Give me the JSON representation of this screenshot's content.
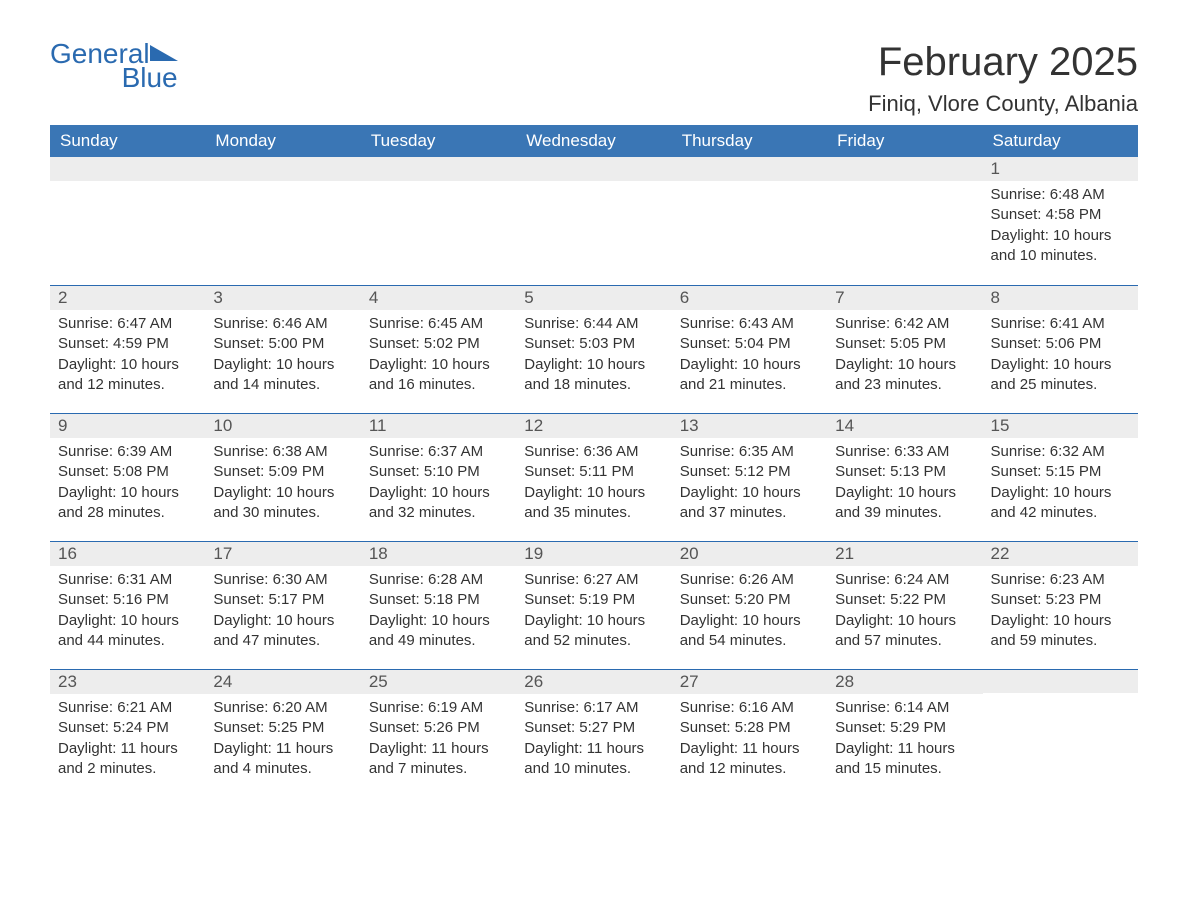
{
  "brand": {
    "general": "General",
    "blue": "Blue"
  },
  "title": "February 2025",
  "location": "Finiq, Vlore County, Albania",
  "day_headers": [
    "Sunday",
    "Monday",
    "Tuesday",
    "Wednesday",
    "Thursday",
    "Friday",
    "Saturday"
  ],
  "weeks": [
    [
      {
        "n": "",
        "lines": []
      },
      {
        "n": "",
        "lines": []
      },
      {
        "n": "",
        "lines": []
      },
      {
        "n": "",
        "lines": []
      },
      {
        "n": "",
        "lines": []
      },
      {
        "n": "",
        "lines": []
      },
      {
        "n": "1",
        "lines": [
          "Sunrise: 6:48 AM",
          "Sunset: 4:58 PM",
          "Daylight: 10 hours and 10 minutes."
        ]
      }
    ],
    [
      {
        "n": "2",
        "lines": [
          "Sunrise: 6:47 AM",
          "Sunset: 4:59 PM",
          "Daylight: 10 hours and 12 minutes."
        ]
      },
      {
        "n": "3",
        "lines": [
          "Sunrise: 6:46 AM",
          "Sunset: 5:00 PM",
          "Daylight: 10 hours and 14 minutes."
        ]
      },
      {
        "n": "4",
        "lines": [
          "Sunrise: 6:45 AM",
          "Sunset: 5:02 PM",
          "Daylight: 10 hours and 16 minutes."
        ]
      },
      {
        "n": "5",
        "lines": [
          "Sunrise: 6:44 AM",
          "Sunset: 5:03 PM",
          "Daylight: 10 hours and 18 minutes."
        ]
      },
      {
        "n": "6",
        "lines": [
          "Sunrise: 6:43 AM",
          "Sunset: 5:04 PM",
          "Daylight: 10 hours and 21 minutes."
        ]
      },
      {
        "n": "7",
        "lines": [
          "Sunrise: 6:42 AM",
          "Sunset: 5:05 PM",
          "Daylight: 10 hours and 23 minutes."
        ]
      },
      {
        "n": "8",
        "lines": [
          "Sunrise: 6:41 AM",
          "Sunset: 5:06 PM",
          "Daylight: 10 hours and 25 minutes."
        ]
      }
    ],
    [
      {
        "n": "9",
        "lines": [
          "Sunrise: 6:39 AM",
          "Sunset: 5:08 PM",
          "Daylight: 10 hours and 28 minutes."
        ]
      },
      {
        "n": "10",
        "lines": [
          "Sunrise: 6:38 AM",
          "Sunset: 5:09 PM",
          "Daylight: 10 hours and 30 minutes."
        ]
      },
      {
        "n": "11",
        "lines": [
          "Sunrise: 6:37 AM",
          "Sunset: 5:10 PM",
          "Daylight: 10 hours and 32 minutes."
        ]
      },
      {
        "n": "12",
        "lines": [
          "Sunrise: 6:36 AM",
          "Sunset: 5:11 PM",
          "Daylight: 10 hours and 35 minutes."
        ]
      },
      {
        "n": "13",
        "lines": [
          "Sunrise: 6:35 AM",
          "Sunset: 5:12 PM",
          "Daylight: 10 hours and 37 minutes."
        ]
      },
      {
        "n": "14",
        "lines": [
          "Sunrise: 6:33 AM",
          "Sunset: 5:13 PM",
          "Daylight: 10 hours and 39 minutes."
        ]
      },
      {
        "n": "15",
        "lines": [
          "Sunrise: 6:32 AM",
          "Sunset: 5:15 PM",
          "Daylight: 10 hours and 42 minutes."
        ]
      }
    ],
    [
      {
        "n": "16",
        "lines": [
          "Sunrise: 6:31 AM",
          "Sunset: 5:16 PM",
          "Daylight: 10 hours and 44 minutes."
        ]
      },
      {
        "n": "17",
        "lines": [
          "Sunrise: 6:30 AM",
          "Sunset: 5:17 PM",
          "Daylight: 10 hours and 47 minutes."
        ]
      },
      {
        "n": "18",
        "lines": [
          "Sunrise: 6:28 AM",
          "Sunset: 5:18 PM",
          "Daylight: 10 hours and 49 minutes."
        ]
      },
      {
        "n": "19",
        "lines": [
          "Sunrise: 6:27 AM",
          "Sunset: 5:19 PM",
          "Daylight: 10 hours and 52 minutes."
        ]
      },
      {
        "n": "20",
        "lines": [
          "Sunrise: 6:26 AM",
          "Sunset: 5:20 PM",
          "Daylight: 10 hours and 54 minutes."
        ]
      },
      {
        "n": "21",
        "lines": [
          "Sunrise: 6:24 AM",
          "Sunset: 5:22 PM",
          "Daylight: 10 hours and 57 minutes."
        ]
      },
      {
        "n": "22",
        "lines": [
          "Sunrise: 6:23 AM",
          "Sunset: 5:23 PM",
          "Daylight: 10 hours and 59 minutes."
        ]
      }
    ],
    [
      {
        "n": "23",
        "lines": [
          "Sunrise: 6:21 AM",
          "Sunset: 5:24 PM",
          "Daylight: 11 hours and 2 minutes."
        ]
      },
      {
        "n": "24",
        "lines": [
          "Sunrise: 6:20 AM",
          "Sunset: 5:25 PM",
          "Daylight: 11 hours and 4 minutes."
        ]
      },
      {
        "n": "25",
        "lines": [
          "Sunrise: 6:19 AM",
          "Sunset: 5:26 PM",
          "Daylight: 11 hours and 7 minutes."
        ]
      },
      {
        "n": "26",
        "lines": [
          "Sunrise: 6:17 AM",
          "Sunset: 5:27 PM",
          "Daylight: 11 hours and 10 minutes."
        ]
      },
      {
        "n": "27",
        "lines": [
          "Sunrise: 6:16 AM",
          "Sunset: 5:28 PM",
          "Daylight: 11 hours and 12 minutes."
        ]
      },
      {
        "n": "28",
        "lines": [
          "Sunrise: 6:14 AM",
          "Sunset: 5:29 PM",
          "Daylight: 11 hours and 15 minutes."
        ]
      },
      {
        "n": "",
        "lines": []
      }
    ]
  ]
}
